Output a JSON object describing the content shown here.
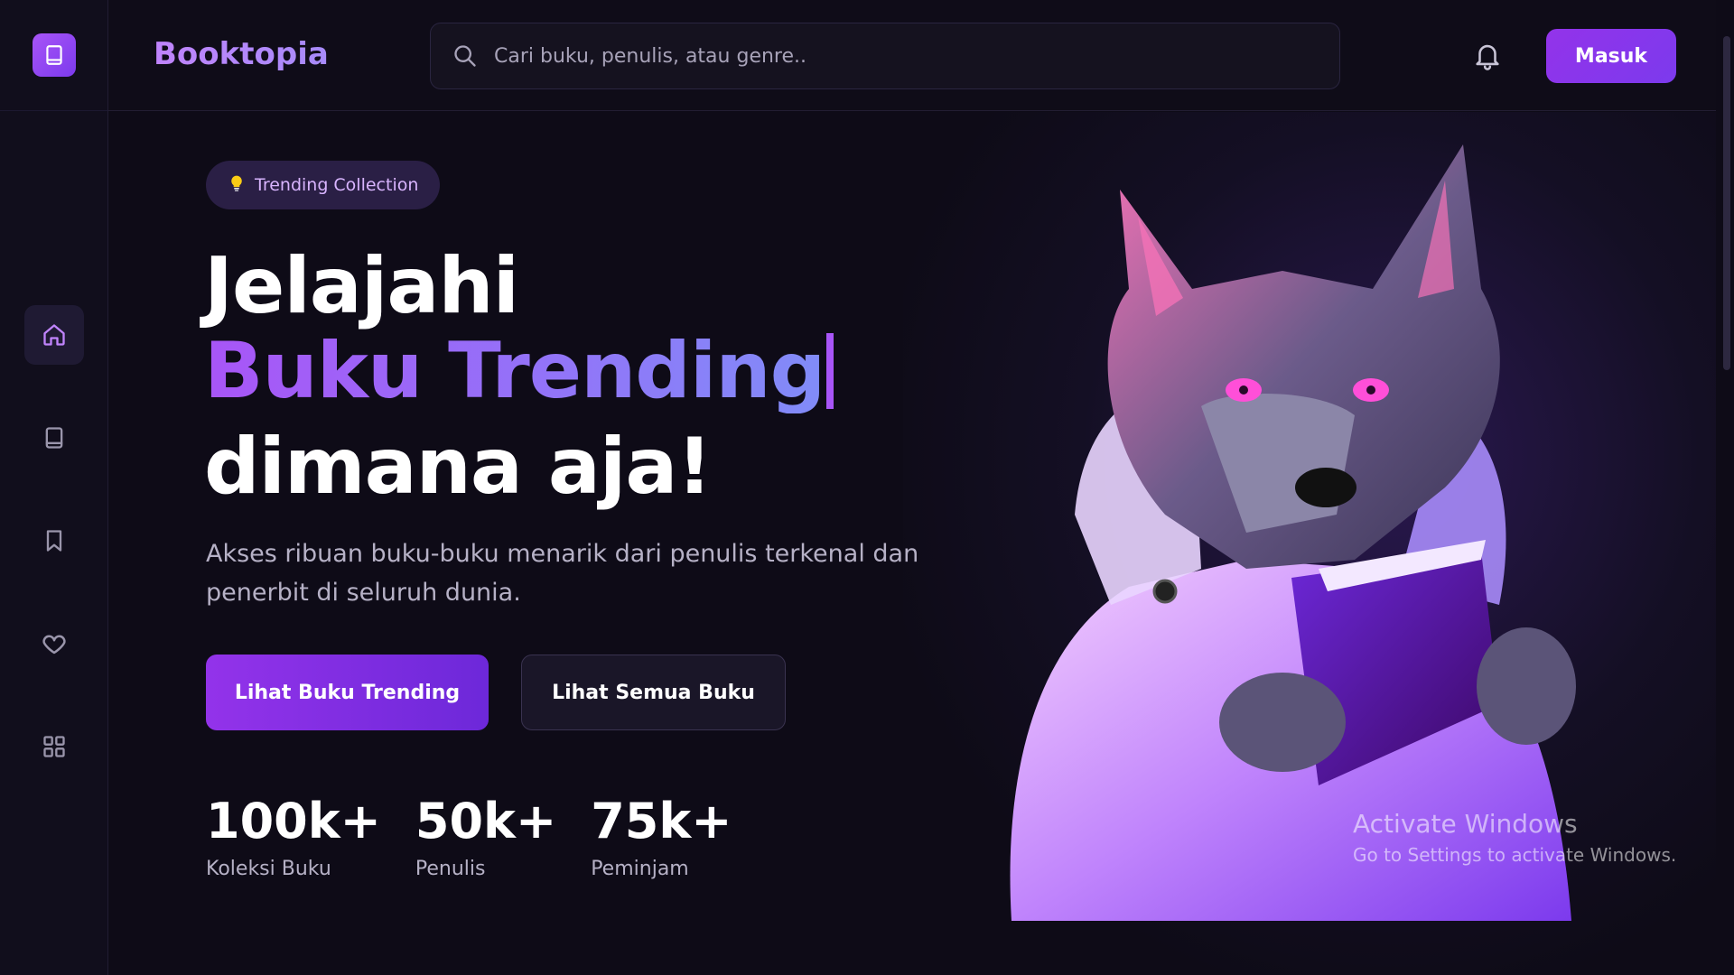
{
  "app": {
    "brand": "Booktopia"
  },
  "search": {
    "placeholder": "Cari buku, penulis, atau genre.."
  },
  "header": {
    "login_label": "Masuk"
  },
  "sidebar": {
    "items": [
      {
        "icon": "home-icon",
        "active": true
      },
      {
        "icon": "book-icon",
        "active": false
      },
      {
        "icon": "bookmark-icon",
        "active": false
      },
      {
        "icon": "heart-icon",
        "active": false
      },
      {
        "icon": "grid-icon",
        "active": false
      }
    ]
  },
  "hero": {
    "badge": "Trending Collection",
    "heading_line1": "Jelajahi",
    "heading_line2": "Buku Trending",
    "heading_line3": "dimana aja!",
    "description": "Akses ribuan buku-buku menarik dari penulis terkenal dan penerbit di seluruh dunia.",
    "primary_button": "Lihat Buku Trending",
    "secondary_button": "Lihat Semua Buku",
    "stats": [
      {
        "value": "100k+",
        "label": "Koleksi Buku"
      },
      {
        "value": "50k+",
        "label": "Penulis"
      },
      {
        "value": "75k+",
        "label": "Peminjam"
      }
    ]
  },
  "overlay": {
    "watermark_title": "Activate Windows",
    "watermark_sub": "Go to Settings to activate Windows."
  },
  "colors": {
    "accent": "#9333ea",
    "accent_light": "#a855f7",
    "background": "#0e0b17"
  }
}
